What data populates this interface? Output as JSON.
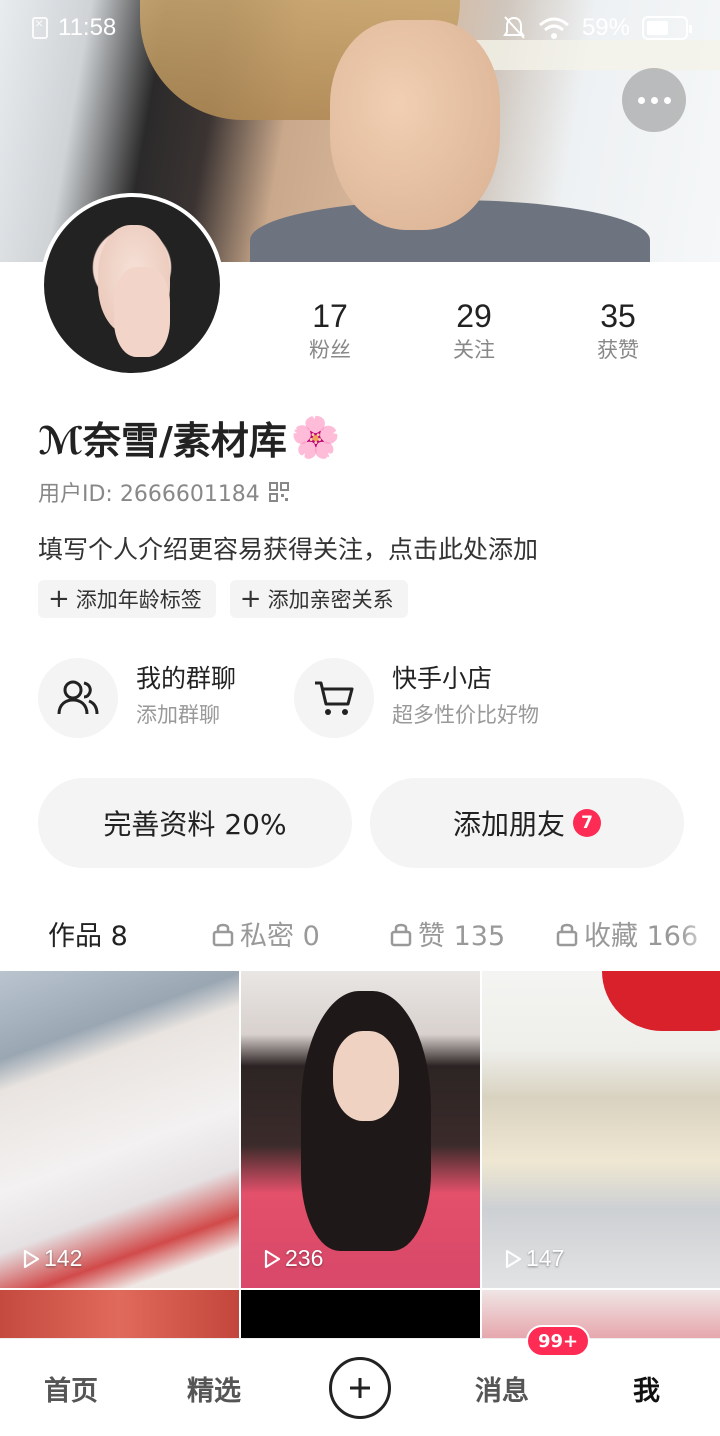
{
  "status_bar": {
    "time": "11:58",
    "battery": "59%",
    "battery_level": 0.59,
    "icons": [
      "sim-off-icon",
      "mute-icon",
      "wifi-icon",
      "battery-icon"
    ]
  },
  "header": {
    "more_icon": "more-horizontal-icon"
  },
  "profile": {
    "stats": [
      {
        "value": "17",
        "label": "粉丝"
      },
      {
        "value": "29",
        "label": "关注"
      },
      {
        "value": "35",
        "label": "获赞"
      }
    ],
    "nickname": "ℳ奈雪/素材库",
    "nickname_emoji": "🌸",
    "user_id": "用户ID: 2666601184",
    "intro_prompt": "填写个人介绍更容易获得关注，点击此处添加",
    "tags": [
      "添加年龄标签",
      "添加亲密关系"
    ]
  },
  "features": [
    {
      "title": "我的群聊",
      "subtitle": "添加群聊",
      "icon": "group-chat-icon"
    },
    {
      "title": "快手小店",
      "subtitle": "超多性价比好物",
      "icon": "shopping-cart-icon"
    }
  ],
  "actions": {
    "complete_profile": "完善资料 20%",
    "add_friends": "添加朋友",
    "add_friends_badge": "7"
  },
  "tabs": [
    {
      "label": "作品 8",
      "active": true,
      "locked": false
    },
    {
      "label": "私密 0",
      "active": false,
      "locked": true
    },
    {
      "label": "赞 135",
      "active": false,
      "locked": true
    },
    {
      "label": "收藏 166",
      "active": false,
      "locked": true
    }
  ],
  "videos": [
    {
      "plays": "142"
    },
    {
      "plays": "236"
    },
    {
      "plays": "147"
    }
  ],
  "bottom_nav": {
    "items": [
      "首页",
      "精选",
      "消息",
      "我"
    ],
    "message_badge": "99+",
    "active": "我"
  },
  "colors": {
    "accent": "#fe2c55",
    "text_primary": "#222222",
    "text_secondary": "#888888",
    "chip_bg": "#f4f4f4"
  }
}
